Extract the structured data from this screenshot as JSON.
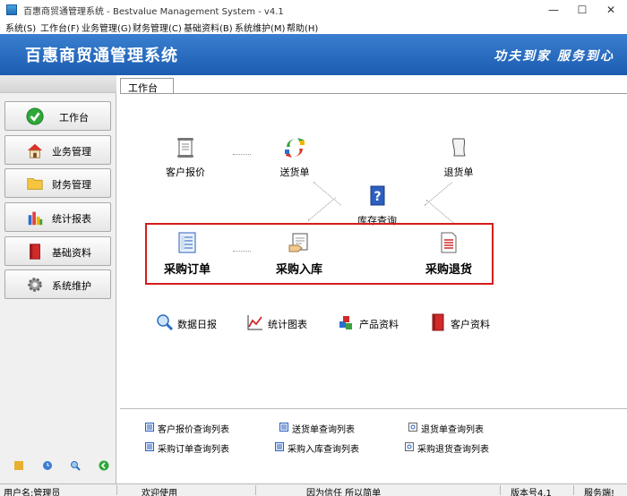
{
  "window": {
    "title": "百惠商贸通管理系统 - Bestvalue Management System - v4.1",
    "controls": [
      "—",
      "☐",
      "✕"
    ]
  },
  "menu": [
    "系统(S)",
    "工作台(F)",
    "业务管理(G)",
    "财务管理(C)",
    "基础资料(B)",
    "系统维护(M)",
    "帮助(H)"
  ],
  "banner": {
    "title": "百惠商贸通管理系统",
    "slogan": "功夫到家 服务到心"
  },
  "sidebar": {
    "items": [
      {
        "label": "工作台",
        "icon": "green-check-icon"
      },
      {
        "label": "业务管理",
        "icon": "house-icon"
      },
      {
        "label": "财务管理",
        "icon": "folder-icon"
      },
      {
        "label": "统计报表",
        "icon": "bar-chart-icon"
      },
      {
        "label": "基础资料",
        "icon": "red-book-icon"
      },
      {
        "label": "系统维护",
        "icon": "gear-icon"
      }
    ]
  },
  "tab": {
    "label": "工作台"
  },
  "workflow": {
    "quote": "客户报价",
    "delivery": "送货单",
    "return": "退货单",
    "stock": "库存查询",
    "purchase_order": "采购订单",
    "purchase_in": "采购入库",
    "purchase_return": "采购退货"
  },
  "quick": {
    "daily": "数据日报",
    "chart": "统计图表",
    "product": "产品资料",
    "customer": "客户资料"
  },
  "links": {
    "quote_list": "客户报价查询列表",
    "delivery_list": "送货单查询列表",
    "return_list": "退货单查询列表",
    "po_list": "采购订单查询列表",
    "in_list": "采购入库查询列表",
    "pr_list": "采购退货查询列表"
  },
  "status": {
    "user": "用户名:管理员",
    "welcome": "欢迎使用",
    "motto": "因为信任 所以简单",
    "version": "版本号4.1",
    "service": "服务端!"
  },
  "colors": {
    "banner": "#1b5cb0",
    "highlight": "#d41c1c"
  }
}
